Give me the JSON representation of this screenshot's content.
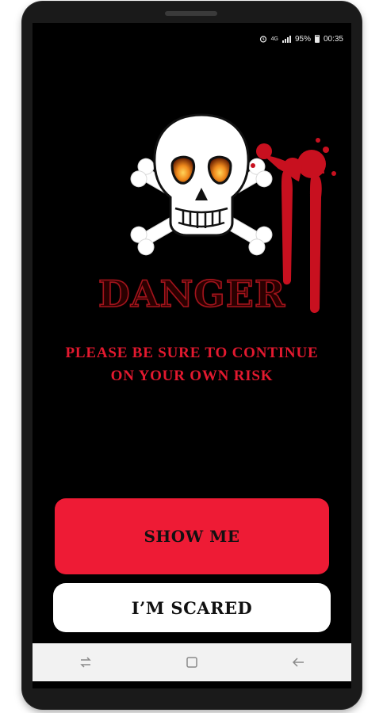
{
  "status_bar": {
    "network": "4G",
    "battery_percent": "95%",
    "time": "00:35"
  },
  "hero": {
    "title": "DANGER"
  },
  "warning": {
    "message": "PLEASE BE SURE TO CONTINUE ON YOUR OWN RISK"
  },
  "actions": {
    "show_me_label": "SHOW ME",
    "scared_label": "I’M SCARED"
  },
  "navigation": {
    "recents_icon": "recents-icon",
    "home_icon": "home-icon",
    "back_icon": "back-icon"
  },
  "colors": {
    "background": "#000000",
    "accent_red": "#ee1b35",
    "warning_text": "#e3192f",
    "secondary_button": "#ffffff",
    "title_outline": "#a3141c"
  }
}
